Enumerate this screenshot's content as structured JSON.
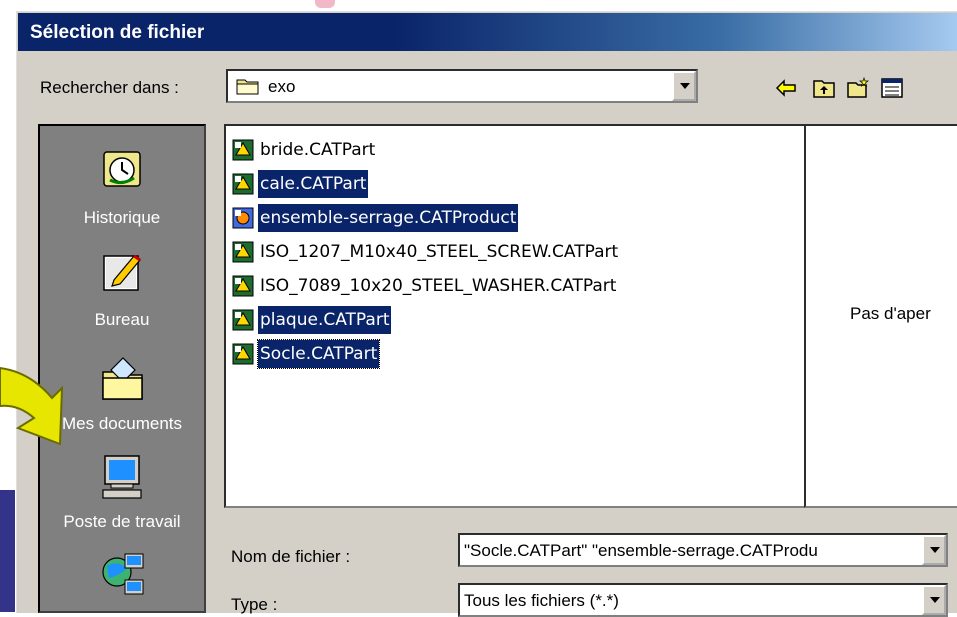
{
  "dialog": {
    "title": "Sélection de fichier",
    "look_in": {
      "label": "Rechercher dans :",
      "value": "exo",
      "icon": "folder-icon"
    },
    "toolbar": [
      "back-arrow-icon",
      "up-folder-icon",
      "new-folder-icon",
      "details-view-icon"
    ]
  },
  "places": [
    {
      "label": "Historique",
      "icon": "history-icon"
    },
    {
      "label": "Bureau",
      "icon": "desktop-icon"
    },
    {
      "label": "Mes documents",
      "icon": "my-documents-icon"
    },
    {
      "label": "Poste de travail",
      "icon": "my-computer-icon"
    },
    {
      "label": "",
      "icon": "network-icon"
    }
  ],
  "files": [
    {
      "name": "bride.CATPart",
      "selected": false,
      "icon": "catpart-icon"
    },
    {
      "name": "cale.CATPart",
      "selected": true,
      "icon": "catpart-icon"
    },
    {
      "name": "ensemble-serrage.CATProduct",
      "selected": true,
      "icon": "catproduct-icon"
    },
    {
      "name": "ISO_1207_M10x40_STEEL_SCREW.CATPart",
      "selected": false,
      "icon": "catpart-icon"
    },
    {
      "name": "ISO_7089_10x20_STEEL_WASHER.CATPart",
      "selected": false,
      "icon": "catpart-icon"
    },
    {
      "name": "plaque.CATPart",
      "selected": true,
      "icon": "catpart-icon"
    },
    {
      "name": "Socle.CATPart",
      "selected": true,
      "focused": true,
      "icon": "catpart-icon"
    }
  ],
  "preview": {
    "text": "Pas d'aper"
  },
  "filename": {
    "label": "Nom de fichier :",
    "value": "\"Socle.CATPart\" \"ensemble-serrage.CATProdu"
  },
  "filetype": {
    "label": "Type :",
    "value": "Tous les fichiers (*.*)"
  },
  "colors": {
    "selection": "#0a246a",
    "title_bar": "#0a246a",
    "dialog_face": "#d4d0c8"
  }
}
